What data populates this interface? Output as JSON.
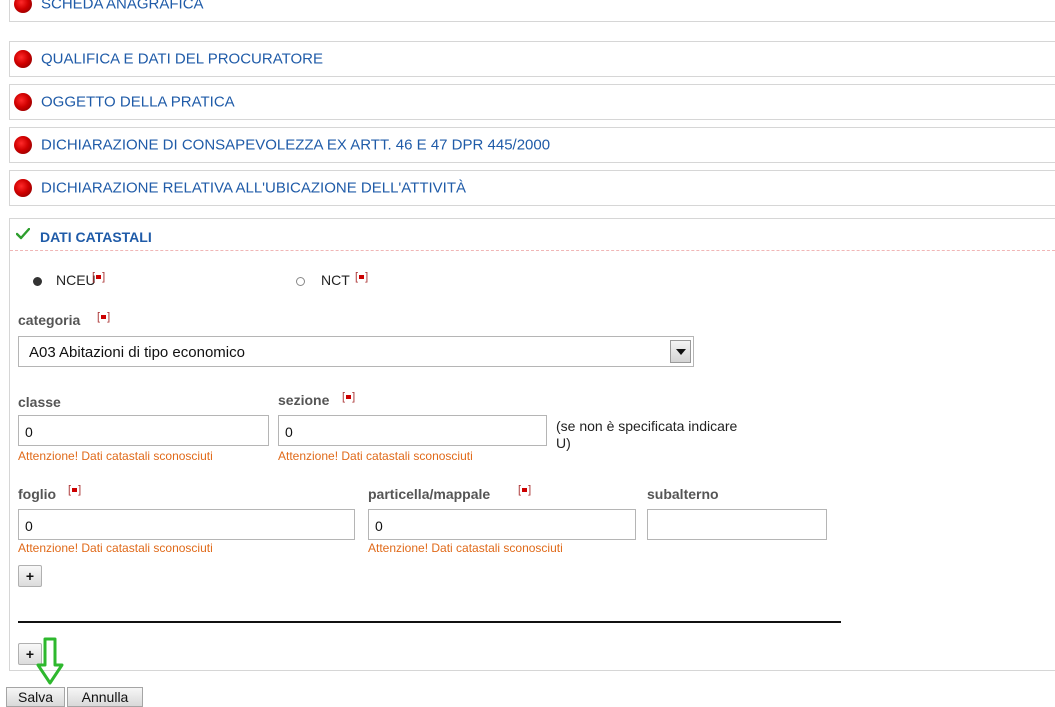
{
  "sections": [
    {
      "label": "SCHEDA ANAGRAFICA"
    },
    {
      "label": "QUALIFICA E DATI DEL PROCURATORE"
    },
    {
      "label": "OGGETTO DELLA PRATICA"
    },
    {
      "label": "DICHIARAZIONE DI CONSAPEVOLEZZA EX ARTT. 46 E 47 DPR 445/2000"
    },
    {
      "label": "DICHIARAZIONE RELATIVA ALL'UBICAZIONE DELL'ATTIVITÀ"
    }
  ],
  "panel": {
    "title": "DATI CATASTALI",
    "radio_nceu": "NCEU",
    "radio_nct": "NCT",
    "selected_radio": "NCEU",
    "required_mark": "[▪]",
    "categoria_label": "categoria",
    "categoria_value": "A03 Abitazioni di tipo economico",
    "classe_label": "classe",
    "classe_value": "0",
    "sezione_label": "sezione",
    "sezione_value": "0",
    "sezione_note": "(se non è specificata indicare U)",
    "foglio_label": "foglio",
    "foglio_value": "0",
    "particella_label": "particella/mappale",
    "particella_value": "0",
    "subalterno_label": "subalterno",
    "subalterno_value": "",
    "warning": "Attenzione! Dati catastali sconosciuti",
    "plus_label": "+"
  },
  "actions": {
    "save": "Salva",
    "cancel": "Annulla"
  },
  "colors": {
    "link_blue": "#1f5ba8",
    "warning_orange": "#e06a1a",
    "check_green": "#2e9e2e",
    "arrow_green": "#2eb82e",
    "required_red": "#cc0000"
  }
}
